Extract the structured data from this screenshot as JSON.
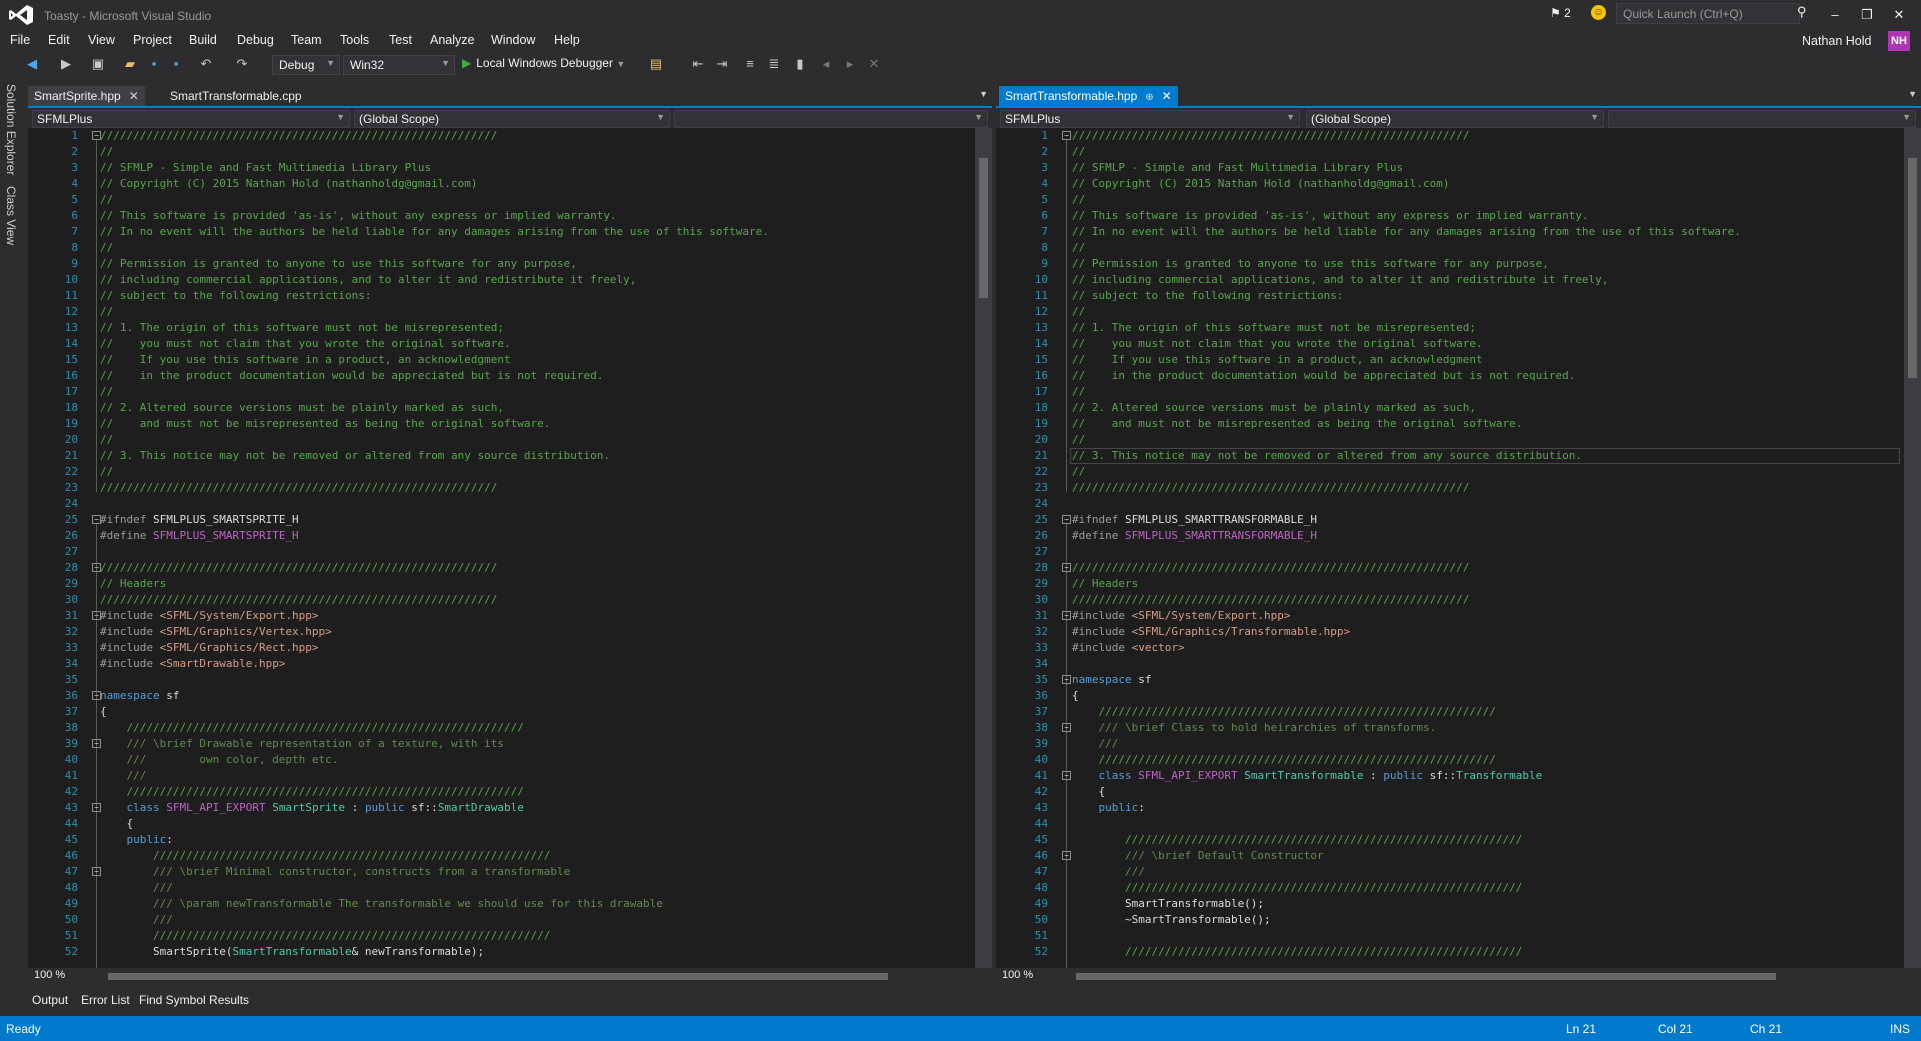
{
  "window": {
    "title": "Toasty - Microsoft Visual Studio",
    "notifications_count": "2",
    "quick_launch_placeholder": "Quick Launch (Ctrl+Q)",
    "user_name": "Nathan Hold",
    "user_initials": "NH"
  },
  "menu": [
    "File",
    "Edit",
    "View",
    "Project",
    "Build",
    "Debug",
    "Team",
    "Tools",
    "Test",
    "Analyze",
    "Window",
    "Help"
  ],
  "toolbar": {
    "configuration": "Debug",
    "platform": "Win32",
    "debugger": "Local Windows Debugger"
  },
  "side_tabs": [
    "Solution Explorer",
    "Class View"
  ],
  "left_pane": {
    "tabs": [
      "SmartSprite.hpp",
      "SmartTransformable.cpp"
    ],
    "project": "SFMLPlus",
    "scope": "(Global Scope)",
    "zoom": "100 %",
    "lines": [
      [
        {
          "c": "comment",
          "t": "////////////////////////////////////////////////////////////"
        }
      ],
      [
        {
          "c": "comment",
          "t": "//"
        }
      ],
      [
        {
          "c": "comment",
          "t": "// SFMLP - Simple and Fast Multimedia Library Plus"
        }
      ],
      [
        {
          "c": "comment",
          "t": "// Copyright (C) 2015 Nathan Hold (nathanholdg@gmail.com)"
        }
      ],
      [
        {
          "c": "comment",
          "t": "//"
        }
      ],
      [
        {
          "c": "comment",
          "t": "// This software is provided 'as-is', without any express or implied warranty."
        }
      ],
      [
        {
          "c": "comment",
          "t": "// In no event will the authors be held liable for any damages arising from the use of this software."
        }
      ],
      [
        {
          "c": "comment",
          "t": "//"
        }
      ],
      [
        {
          "c": "comment",
          "t": "// Permission is granted to anyone to use this software for any purpose,"
        }
      ],
      [
        {
          "c": "comment",
          "t": "// including commercial applications, and to alter it and redistribute it freely,"
        }
      ],
      [
        {
          "c": "comment",
          "t": "// subject to the following restrictions:"
        }
      ],
      [
        {
          "c": "comment",
          "t": "//"
        }
      ],
      [
        {
          "c": "comment",
          "t": "// 1. The origin of this software must not be misrepresented;"
        }
      ],
      [
        {
          "c": "comment",
          "t": "//    you must not claim that you wrote the original software."
        }
      ],
      [
        {
          "c": "comment",
          "t": "//    If you use this software in a product, an acknowledgment"
        }
      ],
      [
        {
          "c": "comment",
          "t": "//    in the product documentation would be appreciated but is not required."
        }
      ],
      [
        {
          "c": "comment",
          "t": "//"
        }
      ],
      [
        {
          "c": "comment",
          "t": "// 2. Altered source versions must be plainly marked as such,"
        }
      ],
      [
        {
          "c": "comment",
          "t": "//    and must not be misrepresented as being the original software."
        }
      ],
      [
        {
          "c": "comment",
          "t": "//"
        }
      ],
      [
        {
          "c": "comment",
          "t": "// 3. This notice may not be removed or altered from any source distribution."
        }
      ],
      [
        {
          "c": "comment",
          "t": "//"
        }
      ],
      [
        {
          "c": "comment",
          "t": "////////////////////////////////////////////////////////////"
        }
      ],
      [],
      [
        {
          "c": "pp",
          "t": "#ifndef "
        },
        {
          "c": "plain",
          "t": "SFMLPLUS_SMARTSPRITE_H"
        }
      ],
      [
        {
          "c": "pp",
          "t": "#define "
        },
        {
          "c": "macro",
          "t": "SFMLPLUS_SMARTSPRITE_H"
        }
      ],
      [],
      [
        {
          "c": "comment",
          "t": "////////////////////////////////////////////////////////////"
        }
      ],
      [
        {
          "c": "comment",
          "t": "// Headers"
        }
      ],
      [
        {
          "c": "comment",
          "t": "////////////////////////////////////////////////////////////"
        }
      ],
      [
        {
          "c": "pp",
          "t": "#include "
        },
        {
          "c": "str",
          "t": "<SFML/System/Export.hpp>"
        }
      ],
      [
        {
          "c": "pp",
          "t": "#include "
        },
        {
          "c": "str",
          "t": "<SFML/Graphics/Vertex.hpp>"
        }
      ],
      [
        {
          "c": "pp",
          "t": "#include "
        },
        {
          "c": "str",
          "t": "<SFML/Graphics/Rect.hpp>"
        }
      ],
      [
        {
          "c": "pp",
          "t": "#include "
        },
        {
          "c": "str",
          "t": "<SmartDrawable.hpp>"
        }
      ],
      [],
      [
        {
          "c": "kw",
          "t": "namespace"
        },
        {
          "c": "plain",
          "t": " sf"
        }
      ],
      [
        {
          "c": "plain",
          "t": "{"
        }
      ],
      [
        {
          "c": "comment",
          "t": "    ////////////////////////////////////////////////////////////"
        }
      ],
      [
        {
          "c": "doc",
          "t": "    /// \\brief Drawable representation of a texture, with its"
        }
      ],
      [
        {
          "c": "doc",
          "t": "    ///        own color, depth etc."
        }
      ],
      [
        {
          "c": "doc",
          "t": "    ///"
        }
      ],
      [
        {
          "c": "comment",
          "t": "    ////////////////////////////////////////////////////////////"
        }
      ],
      [
        {
          "c": "kw",
          "t": "    class"
        },
        {
          "c": "plain",
          "t": " "
        },
        {
          "c": "macro",
          "t": "SFML_API_EXPORT"
        },
        {
          "c": "plain",
          "t": " "
        },
        {
          "c": "type",
          "t": "SmartSprite"
        },
        {
          "c": "plain",
          "t": " : "
        },
        {
          "c": "kw",
          "t": "public"
        },
        {
          "c": "plain",
          "t": " sf::"
        },
        {
          "c": "type",
          "t": "SmartDrawable"
        }
      ],
      [
        {
          "c": "plain",
          "t": "    {"
        }
      ],
      [
        {
          "c": "kw",
          "t": "    public"
        },
        {
          "c": "plain",
          "t": ":"
        }
      ],
      [
        {
          "c": "comment",
          "t": "        ////////////////////////////////////////////////////////////"
        }
      ],
      [
        {
          "c": "doc",
          "t": "        /// \\brief Minimal constructor, constructs from a transformable"
        }
      ],
      [
        {
          "c": "doc",
          "t": "        ///"
        }
      ],
      [
        {
          "c": "doc",
          "t": "        /// \\param newTransformable The transformable we should use for this drawable"
        }
      ],
      [
        {
          "c": "doc",
          "t": "        ///"
        }
      ],
      [
        {
          "c": "comment",
          "t": "        ////////////////////////////////////////////////////////////"
        }
      ],
      [
        {
          "c": "plain",
          "t": "        SmartSprite("
        },
        {
          "c": "type",
          "t": "SmartTransformable"
        },
        {
          "c": "plain",
          "t": "& newTransformable);"
        }
      ]
    ]
  },
  "right_pane": {
    "tabs": [
      "SmartTransformable.hpp"
    ],
    "project": "SFMLPlus",
    "scope": "(Global Scope)",
    "zoom": "100 %",
    "lines": [
      [
        {
          "c": "comment",
          "t": "////////////////////////////////////////////////////////////"
        }
      ],
      [
        {
          "c": "comment",
          "t": "//"
        }
      ],
      [
        {
          "c": "comment",
          "t": "// SFMLP - Simple and Fast Multimedia Library Plus"
        }
      ],
      [
        {
          "c": "comment",
          "t": "// Copyright (C) 2015 Nathan Hold (nathanholdg@gmail.com)"
        }
      ],
      [
        {
          "c": "comment",
          "t": "//"
        }
      ],
      [
        {
          "c": "comment",
          "t": "// This software is provided 'as-is', without any express or implied warranty."
        }
      ],
      [
        {
          "c": "comment",
          "t": "// In no event will the authors be held liable for any damages arising from the use of this software."
        }
      ],
      [
        {
          "c": "comment",
          "t": "//"
        }
      ],
      [
        {
          "c": "comment",
          "t": "// Permission is granted to anyone to use this software for any purpose,"
        }
      ],
      [
        {
          "c": "comment",
          "t": "// including commercial applications, and to alter it and redistribute it freely,"
        }
      ],
      [
        {
          "c": "comment",
          "t": "// subject to the following restrictions:"
        }
      ],
      [
        {
          "c": "comment",
          "t": "//"
        }
      ],
      [
        {
          "c": "comment",
          "t": "// 1. The origin of this software must not be misrepresented;"
        }
      ],
      [
        {
          "c": "comment",
          "t": "//    you must not claim that you wrote the original software."
        }
      ],
      [
        {
          "c": "comment",
          "t": "//    If you use this software in a product, an acknowledgment"
        }
      ],
      [
        {
          "c": "comment",
          "t": "//    in the product documentation would be appreciated but is not required."
        }
      ],
      [
        {
          "c": "comment",
          "t": "//"
        }
      ],
      [
        {
          "c": "comment",
          "t": "// 2. Altered source versions must be plainly marked as such,"
        }
      ],
      [
        {
          "c": "comment",
          "t": "//    and must not be misrepresented as being the original software."
        }
      ],
      [
        {
          "c": "comment",
          "t": "//"
        }
      ],
      [
        {
          "c": "comment",
          "t": "// 3. This notice may not be removed or altered from any source distribution."
        }
      ],
      [
        {
          "c": "comment",
          "t": "//"
        }
      ],
      [
        {
          "c": "comment",
          "t": "////////////////////////////////////////////////////////////"
        }
      ],
      [],
      [
        {
          "c": "pp",
          "t": "#ifndef "
        },
        {
          "c": "plain",
          "t": "SFMLPLUS_SMARTTRANSFORMABLE_H"
        }
      ],
      [
        {
          "c": "pp",
          "t": "#define "
        },
        {
          "c": "macro",
          "t": "SFMLPLUS_SMARTTRANSFORMABLE_H"
        }
      ],
      [],
      [
        {
          "c": "comment",
          "t": "////////////////////////////////////////////////////////////"
        }
      ],
      [
        {
          "c": "comment",
          "t": "// Headers"
        }
      ],
      [
        {
          "c": "comment",
          "t": "////////////////////////////////////////////////////////////"
        }
      ],
      [
        {
          "c": "pp",
          "t": "#include "
        },
        {
          "c": "str",
          "t": "<SFML/System/Export.hpp>"
        }
      ],
      [
        {
          "c": "pp",
          "t": "#include "
        },
        {
          "c": "str",
          "t": "<SFML/Graphics/Transformable.hpp>"
        }
      ],
      [
        {
          "c": "pp",
          "t": "#include "
        },
        {
          "c": "str",
          "t": "<vector>"
        }
      ],
      [],
      [
        {
          "c": "kw",
          "t": "namespace"
        },
        {
          "c": "plain",
          "t": " sf"
        }
      ],
      [
        {
          "c": "plain",
          "t": "{"
        }
      ],
      [
        {
          "c": "comment",
          "t": "    ////////////////////////////////////////////////////////////"
        }
      ],
      [
        {
          "c": "doc",
          "t": "    /// \\brief Class to hold heirarchies of transforms."
        }
      ],
      [
        {
          "c": "doc",
          "t": "    ///"
        }
      ],
      [
        {
          "c": "comment",
          "t": "    ////////////////////////////////////////////////////////////"
        }
      ],
      [
        {
          "c": "kw",
          "t": "    class"
        },
        {
          "c": "plain",
          "t": " "
        },
        {
          "c": "macro",
          "t": "SFML_API_EXPORT"
        },
        {
          "c": "plain",
          "t": " "
        },
        {
          "c": "type",
          "t": "SmartTransformable"
        },
        {
          "c": "plain",
          "t": " : "
        },
        {
          "c": "kw",
          "t": "public"
        },
        {
          "c": "plain",
          "t": " sf::"
        },
        {
          "c": "type",
          "t": "Transformable"
        }
      ],
      [
        {
          "c": "plain",
          "t": "    {"
        }
      ],
      [
        {
          "c": "kw",
          "t": "    public"
        },
        {
          "c": "plain",
          "t": ":"
        }
      ],
      [],
      [
        {
          "c": "comment",
          "t": "        ////////////////////////////////////////////////////////////"
        }
      ],
      [
        {
          "c": "doc",
          "t": "        /// \\brief Default Constructor"
        }
      ],
      [
        {
          "c": "doc",
          "t": "        ///"
        }
      ],
      [
        {
          "c": "comment",
          "t": "        ////////////////////////////////////////////////////////////"
        }
      ],
      [
        {
          "c": "plain",
          "t": "        SmartTransformable();"
        }
      ],
      [
        {
          "c": "plain",
          "t": "        ~SmartTransformable();"
        }
      ],
      [],
      [
        {
          "c": "comment",
          "t": "        ////////////////////////////////////////////////////////////"
        }
      ]
    ]
  },
  "bottom_tabs": [
    "Output",
    "Error List",
    "Find Symbol Results"
  ],
  "status": {
    "message": "Ready",
    "line": "Ln 21",
    "col": "Col 21",
    "ch": "Ch 21",
    "mode": "INS"
  }
}
